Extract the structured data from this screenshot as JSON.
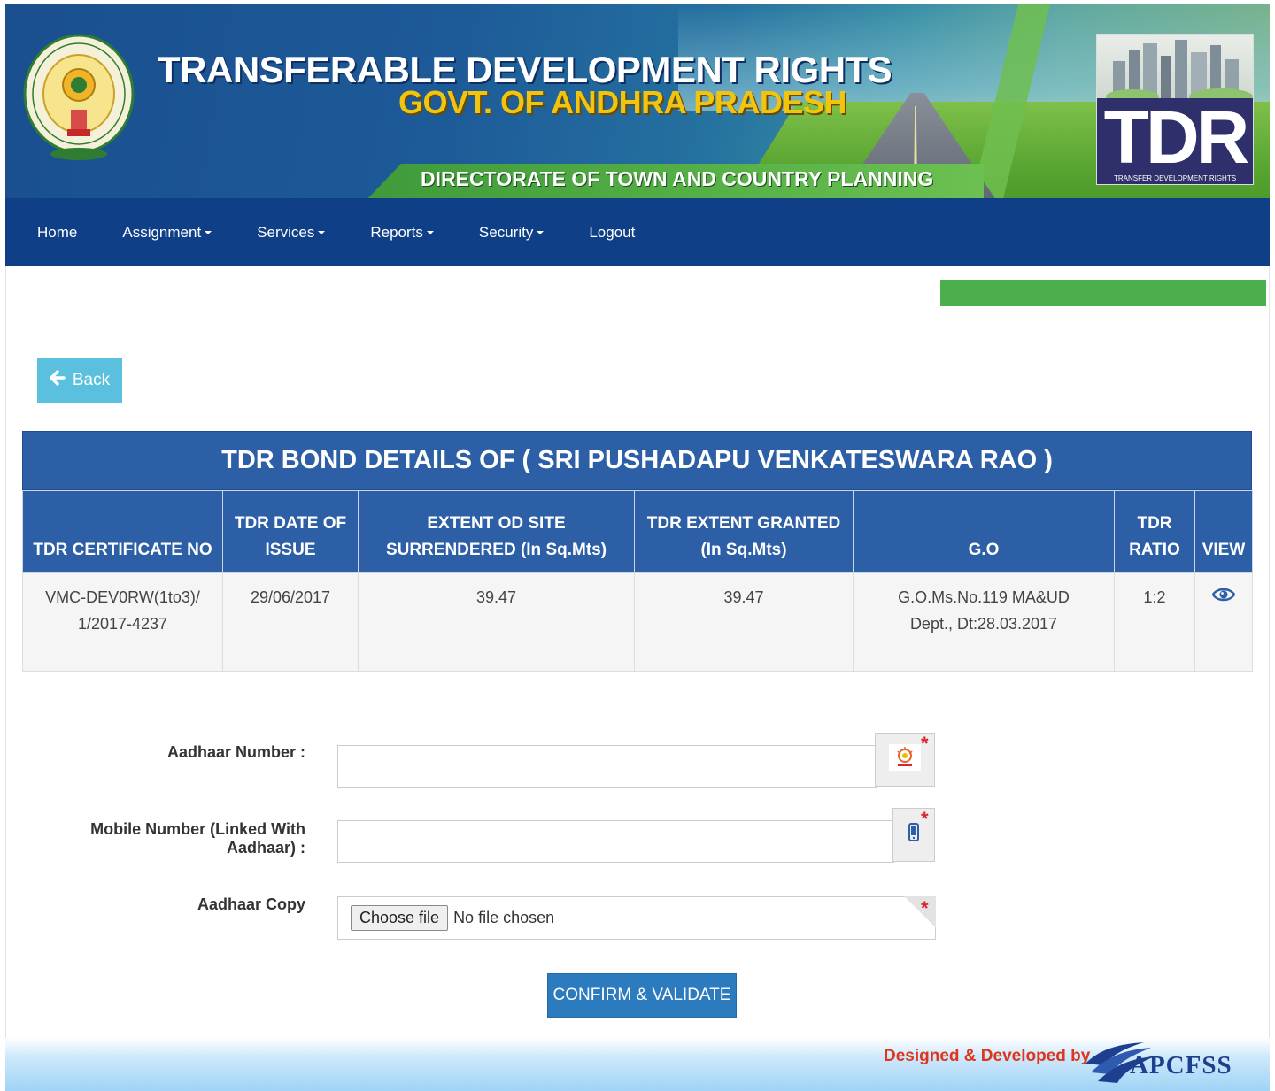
{
  "header": {
    "title": "TRANSFERABLE DEVELOPMENT RIGHTS",
    "subtitle": "GOVT. OF ANDHRA PRADESH",
    "directorate": "DIRECTORATE OF TOWN AND COUNTRY PLANNING",
    "logo_text": "TDR",
    "logo_tagline": "TRANSFER DEVELOPMENT RIGHTS",
    "emblem_icon": "andhra-pradesh-emblem-icon"
  },
  "nav": {
    "items": [
      {
        "label": "Home",
        "dropdown": false
      },
      {
        "label": "Assignment",
        "dropdown": true
      },
      {
        "label": "Services",
        "dropdown": true
      },
      {
        "label": "Reports",
        "dropdown": true
      },
      {
        "label": "Security",
        "dropdown": true
      },
      {
        "label": "Logout",
        "dropdown": false
      }
    ]
  },
  "back_button": {
    "label": "Back",
    "icon": "arrow-left-icon"
  },
  "bond_table": {
    "title": "TDR BOND DETAILS OF ( SRI PUSHADAPU VENKATESWARA RAO )",
    "columns": [
      "TDR CERTIFICATE NO",
      "TDR DATE OF ISSUE",
      "EXTENT OD SITE SURRENDERED (In Sq.Mts)",
      "TDR EXTENT GRANTED (In Sq.Mts)",
      "G.O",
      "TDR RATIO",
      "VIEW"
    ],
    "rows": [
      {
        "certificate_no": "VMC-DEV0RW(1to3)/1/2017-4237",
        "date_of_issue": "29/06/2017",
        "site_surrendered": "39.47",
        "extent_granted": "39.47",
        "go": "G.O.Ms.No.119 MA&UD Dept., Dt:28.03.2017",
        "ratio": "1:2",
        "view_icon": "eye-icon"
      }
    ]
  },
  "form": {
    "aadhaar_label": "Aadhaar Number :",
    "aadhaar_value": "",
    "aadhaar_icon": "aadhaar-logo-icon",
    "mobile_label": "Mobile Number (Linked With Aadhaar) :",
    "mobile_value": "",
    "mobile_icon": "mobile-phone-icon",
    "copy_label": "Aadhaar Copy",
    "file_button": "Choose file",
    "file_status": "No file chosen",
    "required_mark": "*",
    "submit_label": "CONFIRM & VALIDATE"
  },
  "footer": {
    "text": "Designed & Developed by",
    "brand": "APCFSS"
  },
  "colors": {
    "navbar": "#0f3f87",
    "table_header": "#2d5fa7",
    "back_button": "#5bc0de",
    "confirm_button": "#2d7bbf",
    "status_bar": "#4cae4c",
    "required": "#d9262e",
    "footer_text": "#e0341b"
  }
}
